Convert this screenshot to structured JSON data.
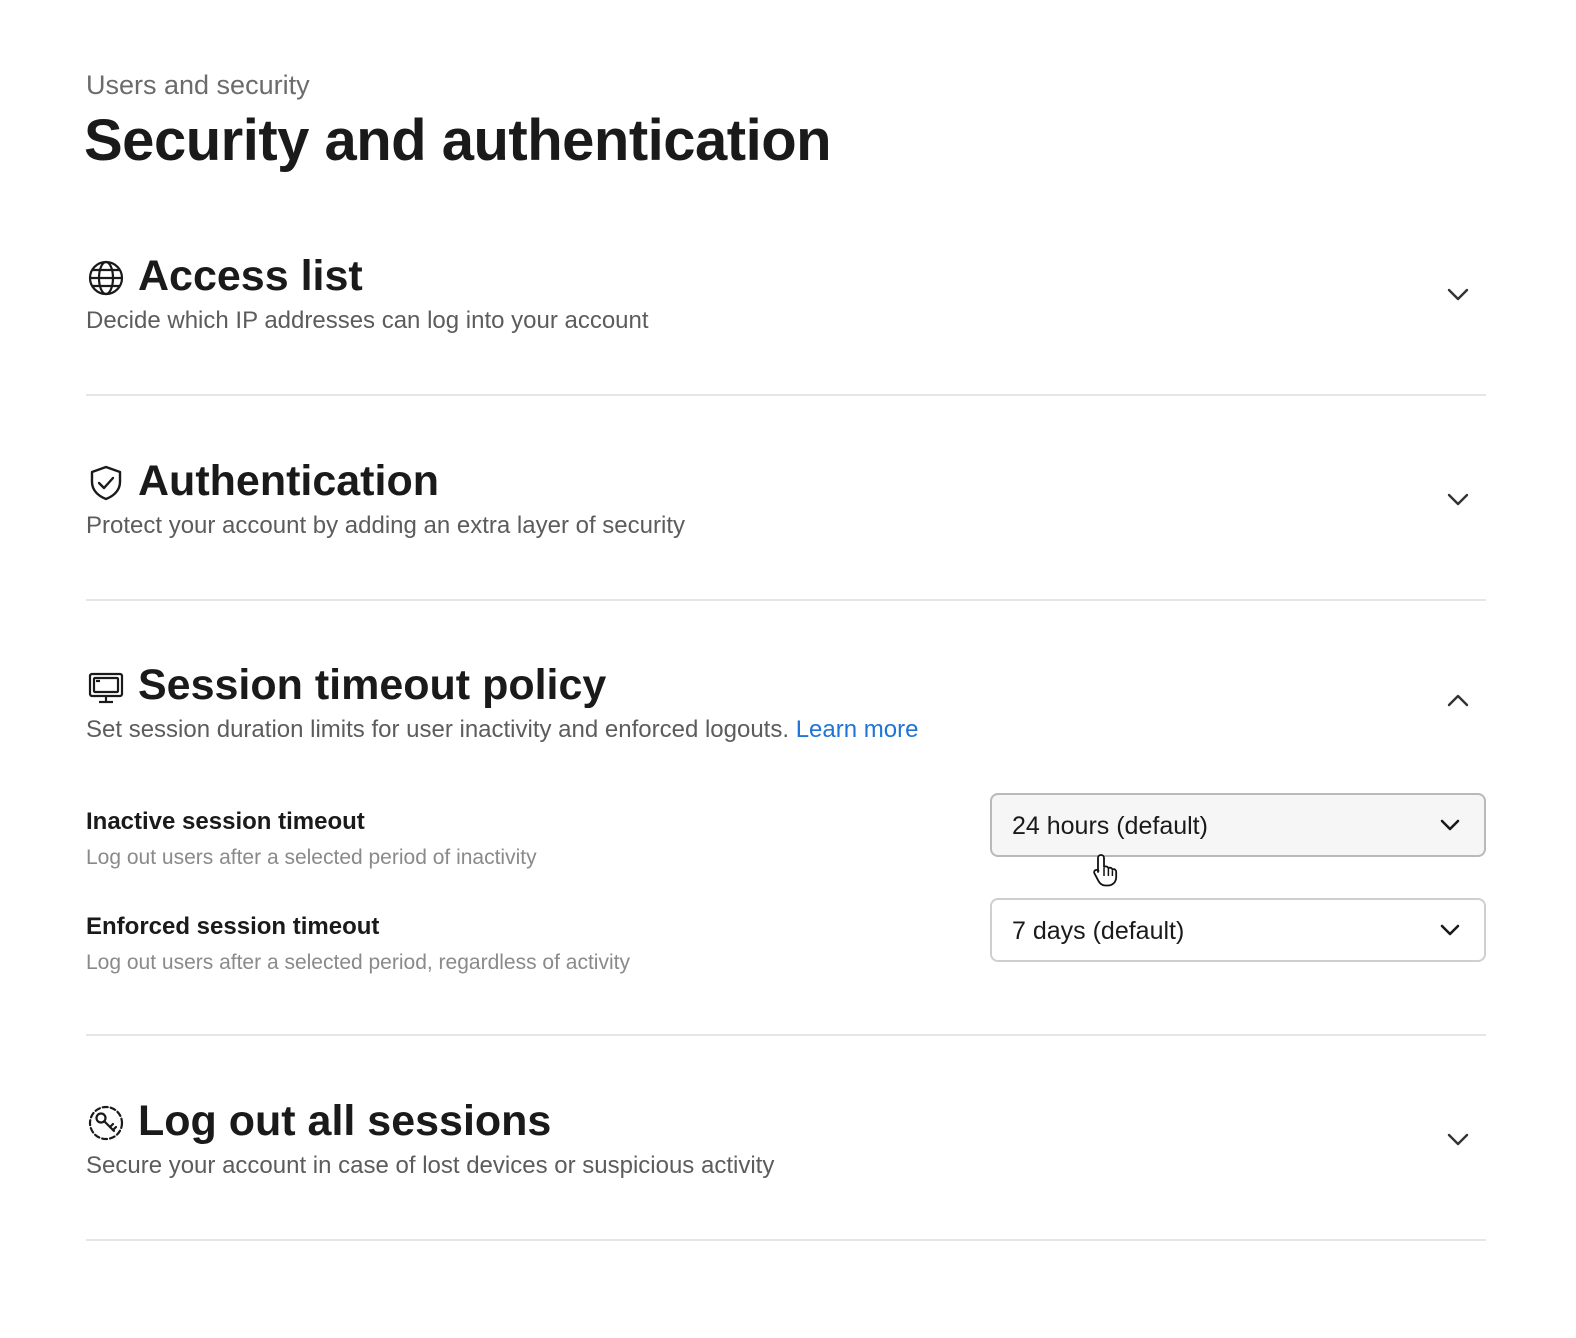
{
  "breadcrumb": "Users and security",
  "page_title": "Security and authentication",
  "sections": {
    "access_list": {
      "icon": "globe-icon",
      "title": "Access list",
      "description": "Decide which IP addresses can log into your account",
      "expanded": false
    },
    "authentication": {
      "icon": "shield-check-icon",
      "title": "Authentication",
      "description": "Protect your account by adding an extra layer of security",
      "expanded": false
    },
    "session_timeout": {
      "icon": "monitor-icon",
      "title": "Session timeout policy",
      "description": "Set session duration limits for user inactivity and enforced logouts.",
      "link_label": "Learn more",
      "expanded": true,
      "settings": {
        "inactive": {
          "label": "Inactive session timeout",
          "help": "Log out users after a selected period of inactivity",
          "value": "24 hours (default)"
        },
        "enforced": {
          "label": "Enforced session timeout",
          "help": "Log out users after a selected period, regardless of activity",
          "value": "7 days (default)"
        }
      }
    },
    "logout_all": {
      "icon": "logout-sessions-icon",
      "title": "Log out all sessions",
      "description": "Secure your account in case of lost devices or suspicious activity",
      "expanded": false
    }
  },
  "colors": {
    "text": "#1a1a1a",
    "muted": "#5c5c5c",
    "help": "#8a8a8a",
    "link": "#1f74d6",
    "divider": "#e6e6e6"
  }
}
